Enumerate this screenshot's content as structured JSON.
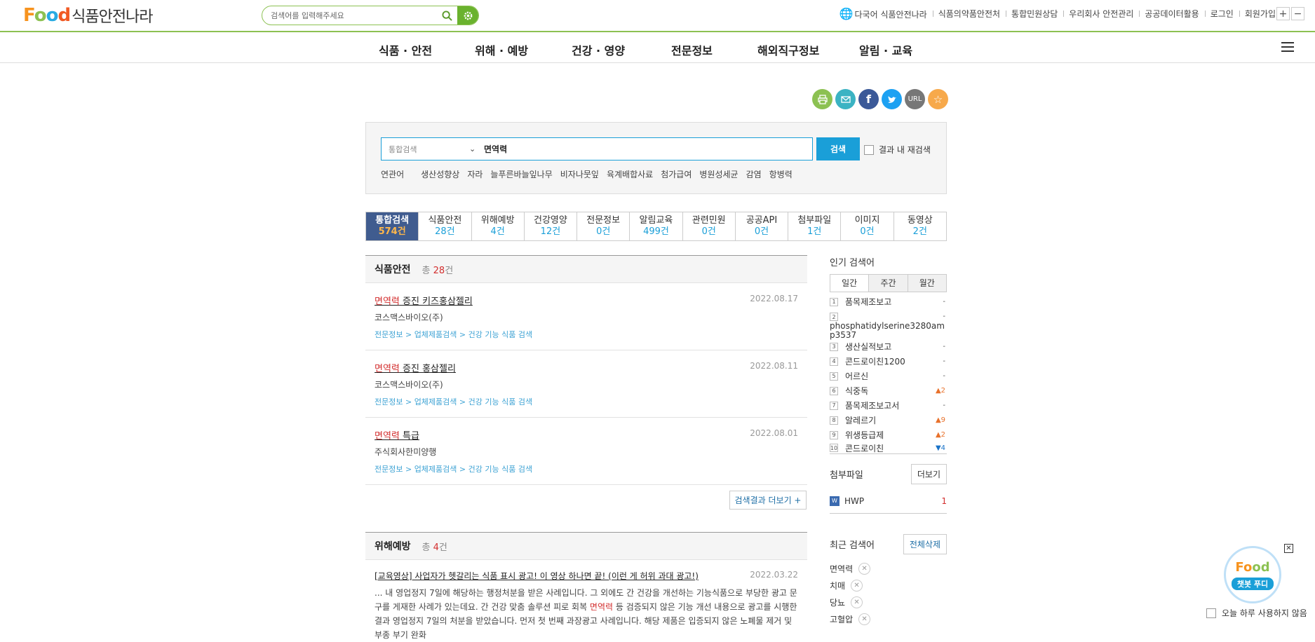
{
  "header": {
    "logo_food": [
      "F",
      "o",
      "o",
      "d"
    ],
    "logo_name": "식품안전나라",
    "search_placeholder": "검색어를 입력해주세요",
    "links": [
      "다국어 식품안전나라",
      "식품의약품안전처",
      "통합민원상담",
      "우리회사 안전관리",
      "공공데이터활용",
      "로그인",
      "회원가입"
    ],
    "zoom_in": "+",
    "zoom_out": "−"
  },
  "gnb": [
    "식품 · 안전",
    "위해 · 예방",
    "건강 · 영양",
    "전문정보",
    "해외직구정보",
    "알림 · 교육"
  ],
  "share": {
    "url": "URL"
  },
  "search": {
    "scope": "통합검색",
    "query": "면역력",
    "button": "검색",
    "research": "결과 내 재검색",
    "related_label": "연관어",
    "related": [
      "생산성향상",
      "자라",
      "늘푸른바늘잎나무",
      "비자나뭇잎",
      "육계배합사료",
      "첨가급여",
      "병원성세균",
      "감염",
      "항병력"
    ]
  },
  "tabs": [
    {
      "label": "통합검색",
      "count": "574건"
    },
    {
      "label": "식품안전",
      "count": "28건"
    },
    {
      "label": "위해예방",
      "count": "4건"
    },
    {
      "label": "건강영양",
      "count": "12건"
    },
    {
      "label": "전문정보",
      "count": "0건"
    },
    {
      "label": "알림교육",
      "count": "499건"
    },
    {
      "label": "관련민원",
      "count": "0건"
    },
    {
      "label": "공공API",
      "count": "0건"
    },
    {
      "label": "첨부파일",
      "count": "1건"
    },
    {
      "label": "이미지",
      "count": "0건"
    },
    {
      "label": "동영상",
      "count": "2건"
    }
  ],
  "section1": {
    "title": "식품안전",
    "total_prefix": "총",
    "total_num": "28",
    "total_suffix": "건",
    "items": [
      {
        "hl": "면역력",
        "rest": " 증진 키즈홍삼젤리",
        "date": "2022.08.17",
        "company": "코스맥스바이오(주)",
        "path": "전문정보 > 업체제품검색 > 건강 기능 식품 검색"
      },
      {
        "hl": "면역력",
        "rest": " 증진 홍삼젤리",
        "date": "2022.08.11",
        "company": "코스맥스바이오(주)",
        "path": "전문정보 > 업체제품검색 > 건강 기능 식품 검색"
      },
      {
        "hl": "면역력",
        "rest": " 특급",
        "date": "2022.08.01",
        "company": "주식회사한미양행",
        "path": "전문정보 > 업체제품검색 > 건강 기능 식품 검색"
      }
    ],
    "more": "검색결과 더보기 +"
  },
  "section2": {
    "title": "위해예방",
    "total_prefix": "총",
    "total_num": "4",
    "total_suffix": "건",
    "item": {
      "title": "[교육영상] 사업자가 헷갈리는 식품 표시 광고! 이 영상 하나면 끝! (이런 게 허위 과대 광고!)",
      "date": "2022.03.22",
      "desc_a": "... 내 영업정지 7일에 해당하는 행정처분을 받은 사례입니다. 그 외에도 간 건강을 개선하는 기능식품으로 부당한 광고 문구를 게재한 사례가 있는데요. 간 건강 맞춤 솔루션 피로 회복 ",
      "desc_hl": "면역력",
      "desc_b": " 등 검증되지 않은 기능 개선 내용으로 광고를 시행한 결과 영업정지 7일의 처분을 받았습니다. 먼저 첫 번째 과장광고 사례입니다. 해당 제품은 입증되지 않은 노폐물 제거 및 부종 부기 완화"
    }
  },
  "popular": {
    "label": "인기 검색어",
    "tabs": [
      "일간",
      "주간",
      "월간"
    ],
    "items": [
      {
        "rank": "1",
        "word": "품목제조보고",
        "change": "-",
        "dir": "nc"
      },
      {
        "rank": "2",
        "word": "phosphatidylserine3280amp3537",
        "change": "-",
        "dir": "nc"
      },
      {
        "rank": "3",
        "word": "생산실적보고",
        "change": "-",
        "dir": "nc"
      },
      {
        "rank": "4",
        "word": "콘드로이친1200",
        "change": "-",
        "dir": "nc"
      },
      {
        "rank": "5",
        "word": "어르신",
        "change": "-",
        "dir": "nc"
      },
      {
        "rank": "6",
        "word": "식중독",
        "change": "▲2",
        "dir": "up"
      },
      {
        "rank": "7",
        "word": "품목제조보고서",
        "change": "-",
        "dir": "nc"
      },
      {
        "rank": "8",
        "word": "알레르기",
        "change": "▲9",
        "dir": "up"
      },
      {
        "rank": "9",
        "word": "위생등급제",
        "change": "▲2",
        "dir": "up"
      },
      {
        "rank": "10",
        "word": "콘드로이친",
        "change": "▼4",
        "dir": "dn"
      }
    ]
  },
  "attachments": {
    "label": "첨부파일",
    "more": "더보기",
    "items": [
      {
        "icon": "W",
        "name": "HWP",
        "count": "1"
      }
    ]
  },
  "recent": {
    "label": "최근 검색어",
    "clear": "전체삭제",
    "items": [
      "면역력",
      "치매",
      "당뇨",
      "고혈압"
    ]
  },
  "chatbot": {
    "face_a": "Fo",
    "face_b": "od",
    "label": "챗봇 푸디",
    "close": "✕",
    "today": "오늘 하루 사용하지 않음"
  }
}
